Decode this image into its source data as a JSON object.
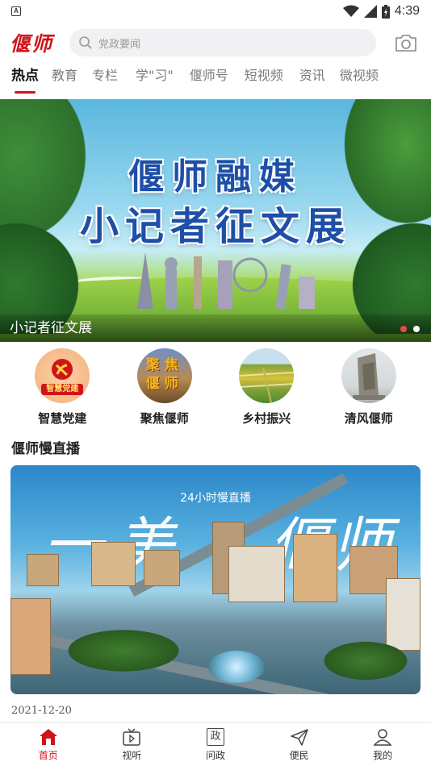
{
  "status_bar": {
    "notification_icon": "A",
    "time": "4:39",
    "icons": [
      "wifi-icon",
      "signal-icon",
      "battery-icon"
    ]
  },
  "header": {
    "logo": "偃师",
    "search_placeholder": "党政要闻",
    "camera_icon": "camera-icon"
  },
  "tabs": [
    {
      "label": "热点",
      "active": true
    },
    {
      "label": "教育",
      "active": false
    },
    {
      "label": "专栏",
      "active": false
    },
    {
      "label": "学\"习\"",
      "active": false
    },
    {
      "label": "偃师号",
      "active": false
    },
    {
      "label": "短视频",
      "active": false
    },
    {
      "label": "资讯",
      "active": false
    },
    {
      "label": "微视频",
      "active": false
    }
  ],
  "banner": {
    "title_line1": "偃师融媒",
    "title_line2": "小记者征文展",
    "caption": "小记者征文展",
    "dots": 2,
    "active_dot": 0
  },
  "quick_nav": [
    {
      "label": "智慧党建",
      "icon": "party-emblem-icon",
      "icon_text": "智慧党建"
    },
    {
      "label": "聚焦偃师",
      "icon": "focus-yanshi-icon",
      "icon_text": "聚焦偃师"
    },
    {
      "label": "乡村振兴",
      "icon": "farmland-icon"
    },
    {
      "label": "清风偃师",
      "icon": "monument-icon"
    }
  ],
  "live_section": {
    "title": "偃师慢直播",
    "video_subtitle": "24小时慢直播",
    "calligraphy_left": "一美",
    "calligraphy_right": "偃师",
    "date": "2021-12-20"
  },
  "bottom_nav": [
    {
      "label": "首页",
      "icon": "home-icon",
      "active": true
    },
    {
      "label": "视听",
      "icon": "tv-icon",
      "active": false
    },
    {
      "label": "问政",
      "icon": "govern-icon",
      "icon_text": "政",
      "active": false
    },
    {
      "label": "便民",
      "icon": "send-icon",
      "active": false
    },
    {
      "label": "我的",
      "icon": "user-icon",
      "active": false
    }
  ],
  "colors": {
    "brand": "#d0151a",
    "tab_inactive": "#7a7a7a",
    "search_bg": "#f1f1f3"
  }
}
